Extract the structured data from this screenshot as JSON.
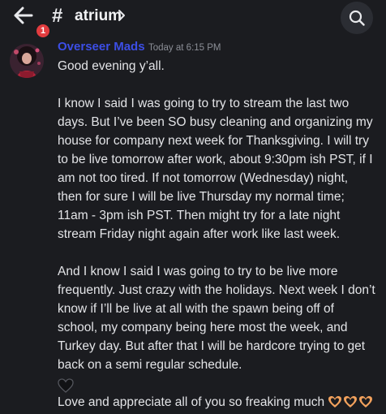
{
  "header": {
    "back_badge_count": "1",
    "channel_prefix": "#",
    "channel_name": "atrium"
  },
  "message": {
    "author": "Overseer Mads",
    "timestamp": "Today at 6:15 PM",
    "greeting": "Good evening y’all.",
    "paragraph1": "I know I said I was going to try to stream the last two days. But I’ve been SO busy cleaning and organizing my house for company next week for Thanksgiving. I will try to be live tomorrow after work, about 9:30pm ish PST, if I am not too tired. If not tomorrow (Wednesday) night, then for sure I will be live Thursday my normal time; 11am - 3pm ish PST. Then might try for a late night stream Friday night again after work like last week.",
    "paragraph2": "And I know I said I was going to try to be live more frequently. Just crazy with the holidays. Next week I don’t know if I’ll be live at all with the spawn being off of school, my company being here most the week, and Turkey day. But after that I will be hardcore trying to get back on a semi regular schedule.",
    "closing": "Love and appreciate all of you so freaking much",
    "closing_emoji": "heart-hands-emoji",
    "trailing_emoji": "black-heart-emoji"
  },
  "colors": {
    "background": "#1b1c20",
    "author_name": "#3c4ee6",
    "badge": "#e23c3f"
  }
}
